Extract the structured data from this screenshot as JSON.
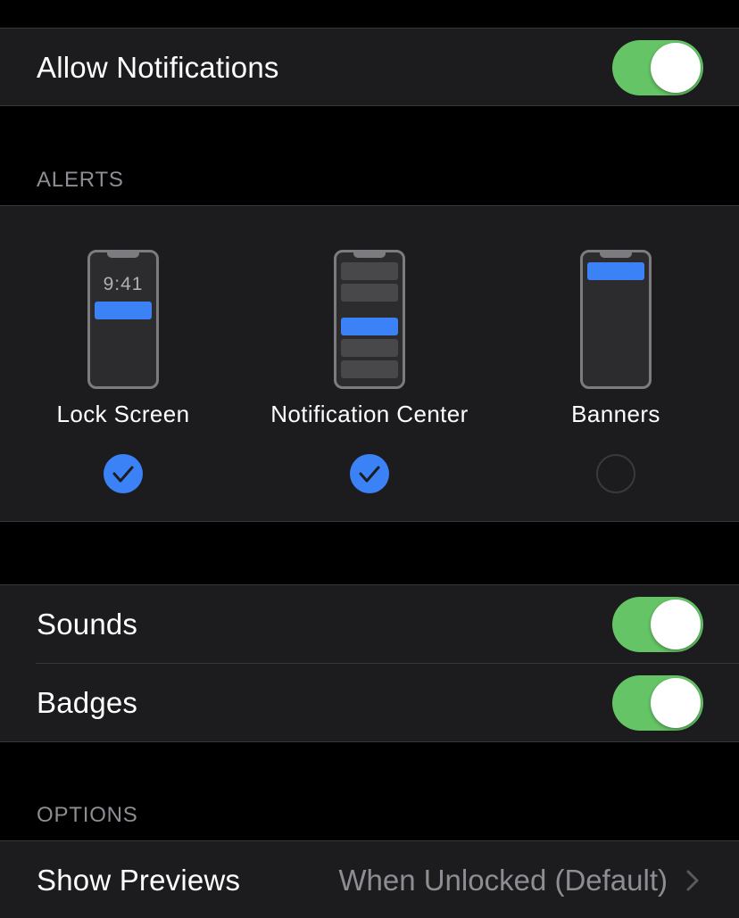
{
  "allow_notifications": {
    "label": "Allow Notifications",
    "enabled": true
  },
  "alerts": {
    "header": "ALERTS",
    "styles": [
      {
        "label": "Lock Screen",
        "checked": true,
        "preview_time": "9:41"
      },
      {
        "label": "Notification Center",
        "checked": true
      },
      {
        "label": "Banners",
        "checked": false
      }
    ]
  },
  "sounds": {
    "label": "Sounds",
    "enabled": true
  },
  "badges": {
    "label": "Badges",
    "enabled": true
  },
  "options": {
    "header": "OPTIONS",
    "show_previews": {
      "label": "Show Previews",
      "value": "When Unlocked (Default)"
    }
  },
  "colors": {
    "toggle_on": "#65c466",
    "accent_blue": "#3b82f6",
    "cell_background": "#1c1c1e",
    "secondary_text": "#8d8d93"
  },
  "icons": [
    "checkmark-icon",
    "chevron-right-icon",
    "lock-screen-preview-icon",
    "notification-center-preview-icon",
    "banners-preview-icon"
  ]
}
